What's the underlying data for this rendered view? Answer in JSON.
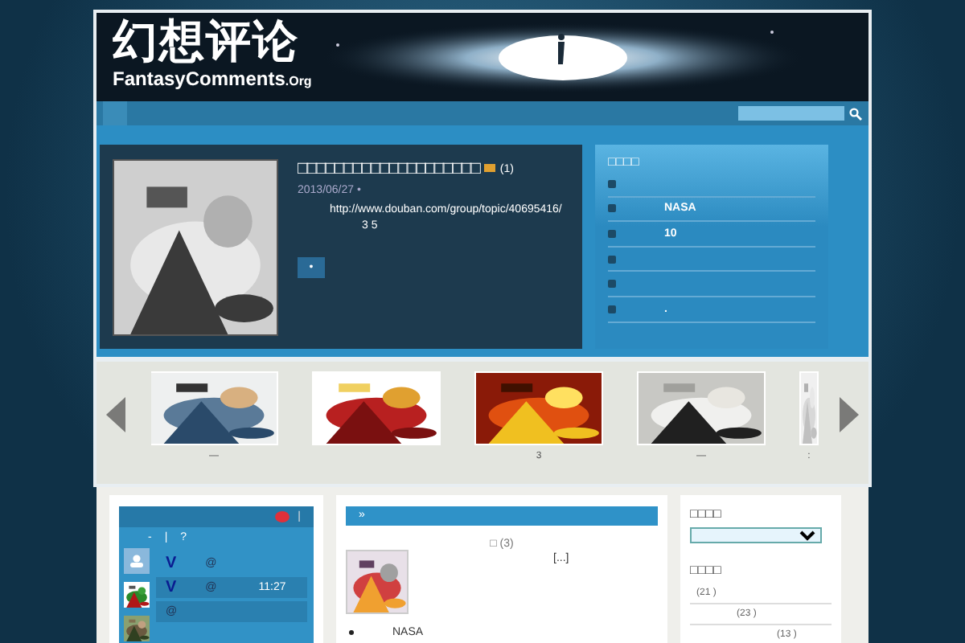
{
  "header": {
    "logo_title": "幻想评论",
    "logo_subtitle": "FantasyComments",
    "logo_suffix": ".Org"
  },
  "feature": {
    "title": "□□□□□□□□□□□□□□□□□□□□",
    "comment_count": "(1)",
    "date": "2013/06/27 •",
    "excerpt": [
      "http://www.douban.com/group/topic/40695416/",
      "3  5"
    ],
    "more_button": "•"
  },
  "side_box": {
    "title": "□□□□",
    "items": [
      {
        "bullet": true
      },
      {
        "bullet": true,
        "text": "NASA"
      },
      {
        "bullet": true,
        "text": "10"
      },
      {
        "bullet": true
      },
      {
        "bullet": true
      },
      {
        "bullet": true,
        "text": "."
      }
    ]
  },
  "carousel": {
    "slides": [
      {
        "kind": "picture",
        "caption": "—"
      },
      {
        "kind": "picture"
      },
      {
        "kind": "picture",
        "caption": "3"
      },
      {
        "kind": "picture",
        "caption": "—"
      },
      {
        "kind": "picture",
        "caption": ":"
      }
    ]
  },
  "weibo": {
    "separator": "|",
    "tab_line": [
      "-",
      "|",
      "?"
    ],
    "posts": [
      {
        "badge": "V",
        "mention": "@"
      },
      {
        "badge": "V",
        "mention": "@",
        "time": "11:27"
      },
      {
        "mention": "@"
      }
    ]
  },
  "recent": {
    "header": "»",
    "post_title": "□ (3)",
    "excerpt": "[...]",
    "list": [
      "NASA"
    ]
  },
  "right_sidebar": {
    "category_title": "□□□□",
    "archive_title": "□□□□",
    "archives": [
      "(21  )",
      "(23  )",
      "(13  )"
    ]
  }
}
